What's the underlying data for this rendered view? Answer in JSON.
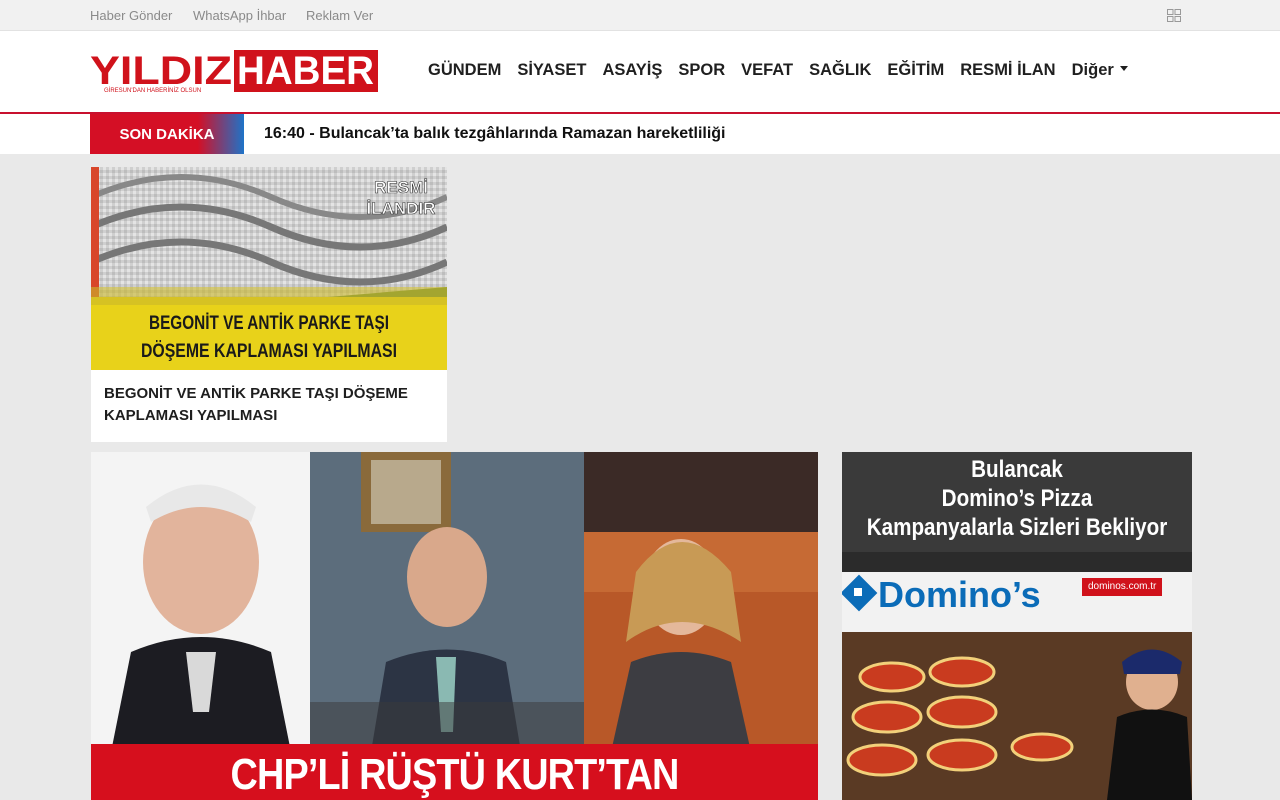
{
  "topbar": {
    "links": [
      "Haber Gönder",
      "WhatsApp İhbar",
      "Reklam Ver"
    ]
  },
  "header": {
    "logo_text": "YILDIZ HABER",
    "logo_tagline": "GİRESUN'DAN HABERİNİZ OLSUN",
    "nav": [
      "GÜNDEM",
      "SİYASET",
      "ASAYİŞ",
      "SPOR",
      "VEFAT",
      "SAĞLIK",
      "EĞİTİM",
      "RESMİ İLAN",
      "Diğer"
    ]
  },
  "breaking": {
    "label": "SON DAKİKA",
    "text": "16:40 - Bulancak’ta balık tezgâhlarında Ramazan hareketliliği"
  },
  "featured": {
    "badge_lines": [
      "RESMİ",
      "İLANDIR"
    ],
    "image_lines": [
      "BEGONİT VE ANTİK PARKE TAŞI",
      "DÖŞEME KAPLAMASI YAPILMASI"
    ],
    "title": "BEGONİT VE ANTİK PARKE TAŞI DÖŞEME KAPLAMASI YAPILMASI"
  },
  "headline": {
    "banner": "CHP’Lİ RÜŞTÜ KURT’TAN"
  },
  "ad": {
    "lines": [
      "Bulancak",
      "Domino’s Pizza",
      "Kampanyalarla Sizleri Bekliyor"
    ],
    "brand": "Domino’s",
    "site": "dominos.com.tr"
  },
  "colors": {
    "accent": "#c8102e",
    "blue": "#1e73c8"
  }
}
